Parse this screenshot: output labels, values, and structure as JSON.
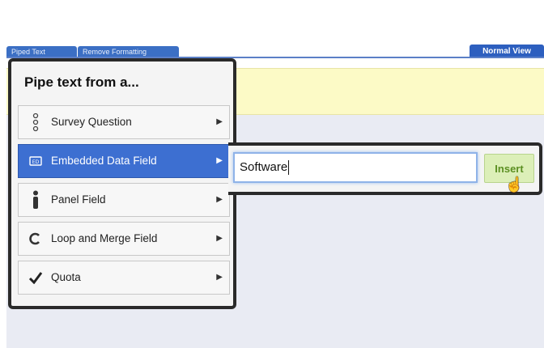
{
  "toolbar": {
    "pipe_text_tab": "Piped Text",
    "remove_formatting_tab": "Remove Formatting",
    "normal_view": "Normal View"
  },
  "menu": {
    "title": "Pipe text from a...",
    "items": [
      {
        "label": "Survey Question",
        "icon": "survey-question-icon",
        "arrow": "▶"
      },
      {
        "label": "Embedded Data Field",
        "icon": "embedded-data-icon",
        "arrow": "▶"
      },
      {
        "label": "Panel Field",
        "icon": "person-icon",
        "arrow": "▶"
      },
      {
        "label": "Loop and Merge Field",
        "icon": "loop-icon",
        "arrow": "▶"
      },
      {
        "label": "Quota",
        "icon": "checkmark-icon",
        "arrow": "▶"
      }
    ]
  },
  "submenu": {
    "field_value": "Software",
    "insert_label": "Insert"
  },
  "colors": {
    "active_item": "#3d6fd1",
    "insert_bg": "#dcefb8",
    "insert_text": "#5b8f22",
    "yellow_band": "#fcfac6"
  }
}
